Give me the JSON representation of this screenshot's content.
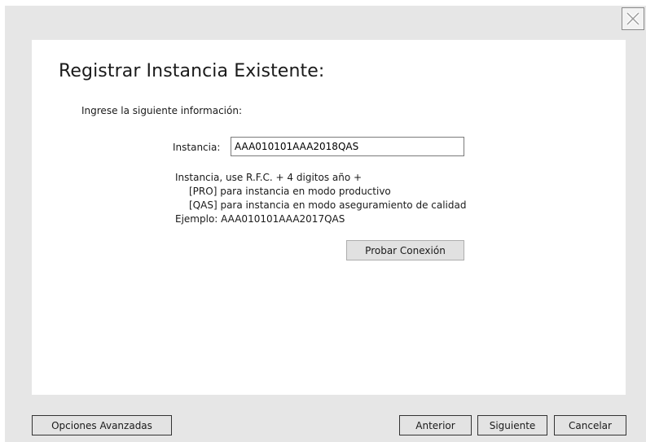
{
  "dialog": {
    "title": "Registrar Instancia Existente:",
    "subtitle": "Ingrese la siguiente información:",
    "instance_label": "Instancia:",
    "instance_value": "AAA010101AAA2018QAS",
    "help_lines": [
      "Instancia, use R.F.C. + 4 digitos año +",
      "[PRO] para instancia en modo productivo",
      "[QAS] para instancia en modo aseguramiento de calidad",
      "Ejemplo:  AAA010101AAA2017QAS"
    ],
    "test_button": "Probar Conexión"
  },
  "footer": {
    "advanced_button": "Opciones Avanzadas",
    "previous_button": "Anterior",
    "next_button": "Siguiente",
    "cancel_button": "Cancelar"
  },
  "icons": {
    "close": "close-icon"
  },
  "colors": {
    "window_bg": "#e6e6e6",
    "panel_bg": "#ffffff",
    "button_bg": "#e1e1e1"
  }
}
